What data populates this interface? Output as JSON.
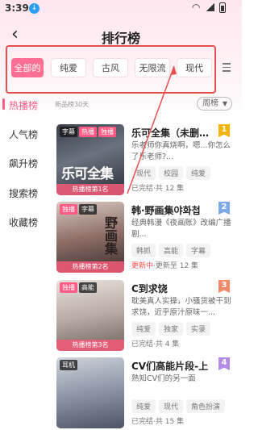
{
  "status": {
    "time": "3:39",
    "download_icon": "download-icon"
  },
  "header": {
    "back_icon": "back-arrow-icon",
    "title": "排行榜"
  },
  "tabs": [
    {
      "label": "全部的",
      "active": true
    },
    {
      "label": "纯爱",
      "active": false
    },
    {
      "label": "古风",
      "active": false
    },
    {
      "label": "无限流",
      "active": false
    },
    {
      "label": "现代",
      "active": false
    }
  ],
  "sidebar": {
    "items": [
      {
        "label": "热播榜",
        "active": true
      },
      {
        "label": "人气榜",
        "active": false
      },
      {
        "label": "飙升榜",
        "active": false
      },
      {
        "label": "搜索榜",
        "active": false
      },
      {
        "label": "收藏榜",
        "active": false
      }
    ]
  },
  "subbar": {
    "note": "新品榜30天",
    "period": "周榜"
  },
  "cards": [
    {
      "title": "乐可全集（未删…",
      "desc": "乐老师你真烧啊，嗯...你怎么了乐老师?...",
      "tags": [
        "现代",
        "校园",
        "纯爱"
      ],
      "status_prefix": "",
      "status": "已完结·共 12 集",
      "badges": [
        {
          "text": "字幕",
          "style": "dark"
        },
        {
          "text": "热播",
          "style": "pink"
        },
        {
          "text": "独播",
          "style": "pink"
        }
      ],
      "cover_label": "热播榜第1名",
      "cover_big_text": "乐可全集",
      "rank": "1",
      "rank_color": "#f5b400"
    },
    {
      "title": "韩·野画集야화첩",
      "desc": "经典韩漫《夜画账》改编广播剧...",
      "tags": [
        "韩抓",
        "高能",
        "字幕"
      ],
      "status_prefix": "更新中",
      "status": "·更新至 12 集",
      "badges": [
        {
          "text": "独播",
          "style": "pink"
        },
        {
          "text": "字幕",
          "style": "dark"
        }
      ],
      "cover_label": "热播榜第2名",
      "cover_big_text": "野画集",
      "rank": "2",
      "rank_color": "#7fa8e8"
    },
    {
      "title": "C到求饶",
      "desc": "耽美真人实操，小骚货被干到求饶，近乎原汁原味一...",
      "tags": [
        "纯爱",
        "独家",
        "实录"
      ],
      "status_prefix": "",
      "status": "已完结·共 4 集",
      "badges": [
        {
          "text": "独播",
          "style": "pink"
        },
        {
          "text": "高能",
          "style": "dark"
        }
      ],
      "cover_label": "热播榜第3名",
      "cover_big_text": "",
      "rank": "3",
      "rank_color": "#f08a6a"
    },
    {
      "title": "CV们高能片段-上",
      "desc": "熟知CV们的另一面",
      "tags": [
        "纯爱",
        "现代",
        "角色扮演"
      ],
      "status_prefix": "",
      "status": "已完结·共 15 集",
      "badges": [
        {
          "text": "耳机",
          "style": "dark"
        }
      ],
      "cover_label": "",
      "cover_big_text": "",
      "rank": "4",
      "rank_color": "#b58be8"
    }
  ],
  "colors": {
    "accent": "#ff5c85",
    "highlight_box": "#e85050"
  }
}
